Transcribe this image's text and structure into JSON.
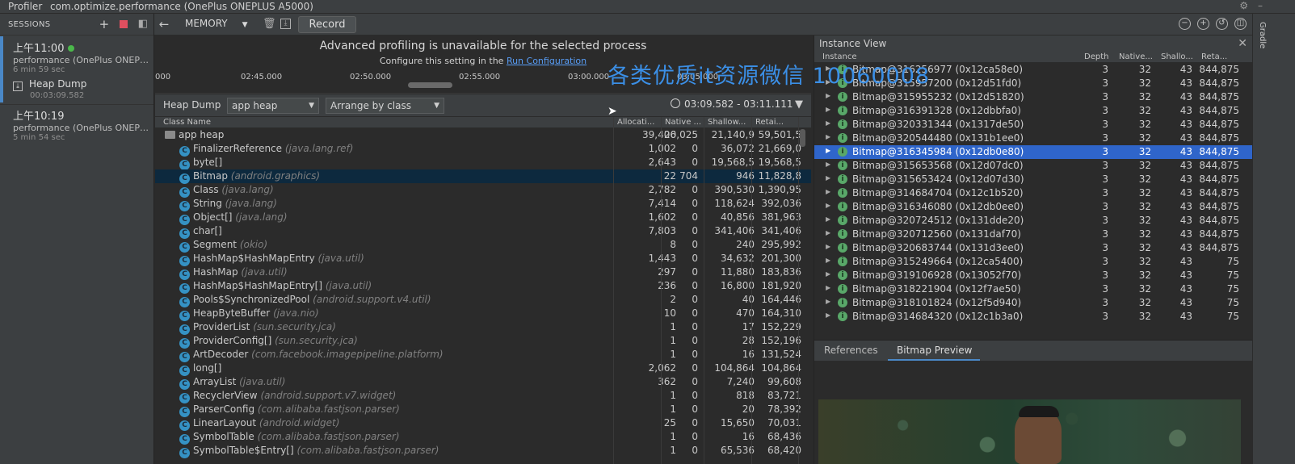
{
  "titlebar": {
    "tab1": "Profiler",
    "tab2": "com.optimize.performance (OnePlus ONEPLUS A5000)"
  },
  "sessions": {
    "header": "SESSIONS",
    "items": [
      {
        "time": "上午11:00",
        "device": "performance (OnePlus ONEPLUS ...",
        "duration": "6 min 59 sec"
      },
      {
        "label": "Heap Dump",
        "duration": "00:03:09.582"
      },
      {
        "time": "上午10:19",
        "device": "performance (OnePlus ONEPLUS ...",
        "duration": "5 min 54 sec"
      }
    ]
  },
  "toolbar": {
    "profiler": "MEMORY",
    "record": "Record"
  },
  "banner": {
    "line1": "Advanced profiling is unavailable for the selected process",
    "line2_prefix": "Configure this setting in the",
    "link": "Run Configuration"
  },
  "timeline": {
    "ticks": [
      "000",
      "02:45.000",
      "02:50.000",
      "02:55.000",
      "03:00.000",
      "03:05.000"
    ]
  },
  "filterbar": {
    "view": "Heap Dump",
    "heap": "app heap",
    "arrange": "Arrange by class",
    "range": "03:09.582 - 03:11.111"
  },
  "class_table": {
    "headers": [
      "Class Name",
      "Allocati...",
      "Native ...",
      "Shallow...",
      "Retai..."
    ],
    "root": {
      "name": "app heap",
      "alloc": "39,406",
      "native": "20,025",
      "shallow": "21,140,9",
      "retained": "59,501,5"
    },
    "rows": [
      {
        "name": "FinalizerReference",
        "pkg": "(java.lang.ref)",
        "alloc": "1,002",
        "native": "0",
        "shallow": "36,072",
        "retained": "21,669,0"
      },
      {
        "name": "byte[]",
        "pkg": "",
        "alloc": "2,643",
        "native": "0",
        "shallow": "19,568,5",
        "retained": "19,568,5"
      },
      {
        "name": "Bitmap",
        "pkg": "(android.graphics)",
        "alloc": "22",
        "native": "704",
        "shallow": "946",
        "retained": "11,828,8"
      },
      {
        "name": "Class",
        "pkg": "(java.lang)",
        "alloc": "2,782",
        "native": "0",
        "shallow": "390,530",
        "retained": "1,390,95"
      },
      {
        "name": "String",
        "pkg": "(java.lang)",
        "alloc": "7,414",
        "native": "0",
        "shallow": "118,624",
        "retained": "392,036"
      },
      {
        "name": "Object[]",
        "pkg": "(java.lang)",
        "alloc": "1,602",
        "native": "0",
        "shallow": "40,856",
        "retained": "381,963"
      },
      {
        "name": "char[]",
        "pkg": "",
        "alloc": "7,803",
        "native": "0",
        "shallow": "341,406",
        "retained": "341,406"
      },
      {
        "name": "Segment",
        "pkg": "(okio)",
        "alloc": "8",
        "native": "0",
        "shallow": "240",
        "retained": "295,992"
      },
      {
        "name": "HashMap$HashMapEntry",
        "pkg": "(java.util)",
        "alloc": "1,443",
        "native": "0",
        "shallow": "34,632",
        "retained": "201,300"
      },
      {
        "name": "HashMap",
        "pkg": "(java.util)",
        "alloc": "297",
        "native": "0",
        "shallow": "11,880",
        "retained": "183,836"
      },
      {
        "name": "HashMap$HashMapEntry[]",
        "pkg": "(java.util)",
        "alloc": "236",
        "native": "0",
        "shallow": "16,800",
        "retained": "181,920"
      },
      {
        "name": "Pools$SynchronizedPool",
        "pkg": "(android.support.v4.util)",
        "alloc": "2",
        "native": "0",
        "shallow": "40",
        "retained": "164,446"
      },
      {
        "name": "HeapByteBuffer",
        "pkg": "(java.nio)",
        "alloc": "10",
        "native": "0",
        "shallow": "470",
        "retained": "164,310"
      },
      {
        "name": "ProviderList",
        "pkg": "(sun.security.jca)",
        "alloc": "1",
        "native": "0",
        "shallow": "17",
        "retained": "152,229"
      },
      {
        "name": "ProviderConfig[]",
        "pkg": "(sun.security.jca)",
        "alloc": "1",
        "native": "0",
        "shallow": "28",
        "retained": "152,196"
      },
      {
        "name": "ArtDecoder",
        "pkg": "(com.facebook.imagepipeline.platform)",
        "alloc": "1",
        "native": "0",
        "shallow": "16",
        "retained": "131,524"
      },
      {
        "name": "long[]",
        "pkg": "",
        "alloc": "2,062",
        "native": "0",
        "shallow": "104,864",
        "retained": "104,864"
      },
      {
        "name": "ArrayList",
        "pkg": "(java.util)",
        "alloc": "362",
        "native": "0",
        "shallow": "7,240",
        "retained": "99,608"
      },
      {
        "name": "RecyclerView",
        "pkg": "(android.support.v7.widget)",
        "alloc": "1",
        "native": "0",
        "shallow": "818",
        "retained": "83,721"
      },
      {
        "name": "ParserConfig",
        "pkg": "(com.alibaba.fastjson.parser)",
        "alloc": "1",
        "native": "0",
        "shallow": "20",
        "retained": "78,392"
      },
      {
        "name": "LinearLayout",
        "pkg": "(android.widget)",
        "alloc": "25",
        "native": "0",
        "shallow": "15,650",
        "retained": "70,031"
      },
      {
        "name": "SymbolTable",
        "pkg": "(com.alibaba.fastjson.parser)",
        "alloc": "1",
        "native": "0",
        "shallow": "16",
        "retained": "68,436"
      },
      {
        "name": "SymbolTable$Entry[]",
        "pkg": "(com.alibaba.fastjson.parser)",
        "alloc": "1",
        "native": "0",
        "shallow": "65,536",
        "retained": "68,420"
      }
    ],
    "selected_index": 2
  },
  "instance_view": {
    "title": "Instance View",
    "headers": [
      "Instance",
      "Depth",
      "Native...",
      "Shallo...",
      "Reta..."
    ],
    "rows": [
      {
        "name": "Bitmap@316256977 (0x12ca58e0)",
        "depth": "3",
        "native": "32",
        "shallow": "43",
        "retained": "844,875"
      },
      {
        "name": "Bitmap@315957200 (0x12d51fd0)",
        "depth": "3",
        "native": "32",
        "shallow": "43",
        "retained": "844,875"
      },
      {
        "name": "Bitmap@315955232 (0x12d51820)",
        "depth": "3",
        "native": "32",
        "shallow": "43",
        "retained": "844,875"
      },
      {
        "name": "Bitmap@316391328 (0x12dbbfa0)",
        "depth": "3",
        "native": "32",
        "shallow": "43",
        "retained": "844,875"
      },
      {
        "name": "Bitmap@320331344 (0x1317de50)",
        "depth": "3",
        "native": "32",
        "shallow": "43",
        "retained": "844,875"
      },
      {
        "name": "Bitmap@320544480 (0x131b1ee0)",
        "depth": "3",
        "native": "32",
        "shallow": "43",
        "retained": "844,875"
      },
      {
        "name": "Bitmap@316345984 (0x12db0e80)",
        "depth": "3",
        "native": "32",
        "shallow": "43",
        "retained": "844,875"
      },
      {
        "name": "Bitmap@315653568 (0x12d07dc0)",
        "depth": "3",
        "native": "32",
        "shallow": "43",
        "retained": "844,875"
      },
      {
        "name": "Bitmap@315653424 (0x12d07d30)",
        "depth": "3",
        "native": "32",
        "shallow": "43",
        "retained": "844,875"
      },
      {
        "name": "Bitmap@314684704 (0x12c1b520)",
        "depth": "3",
        "native": "32",
        "shallow": "43",
        "retained": "844,875"
      },
      {
        "name": "Bitmap@316346080 (0x12db0ee0)",
        "depth": "3",
        "native": "32",
        "shallow": "43",
        "retained": "844,875"
      },
      {
        "name": "Bitmap@320724512 (0x131dde20)",
        "depth": "3",
        "native": "32",
        "shallow": "43",
        "retained": "844,875"
      },
      {
        "name": "Bitmap@320712560 (0x131daf70)",
        "depth": "3",
        "native": "32",
        "shallow": "43",
        "retained": "844,875"
      },
      {
        "name": "Bitmap@320683744 (0x131d3ee0)",
        "depth": "3",
        "native": "32",
        "shallow": "43",
        "retained": "844,875"
      },
      {
        "name": "Bitmap@315249664 (0x12ca5400)",
        "depth": "3",
        "native": "32",
        "shallow": "43",
        "retained": "75"
      },
      {
        "name": "Bitmap@319106928 (0x13052f70)",
        "depth": "3",
        "native": "32",
        "shallow": "43",
        "retained": "75"
      },
      {
        "name": "Bitmap@318221904 (0x12f7ae50)",
        "depth": "3",
        "native": "32",
        "shallow": "43",
        "retained": "75"
      },
      {
        "name": "Bitmap@318101824 (0x12f5d940)",
        "depth": "3",
        "native": "32",
        "shallow": "43",
        "retained": "75"
      },
      {
        "name": "Bitmap@314684320 (0x12c1b3a0)",
        "depth": "3",
        "native": "32",
        "shallow": "43",
        "retained": "75"
      }
    ],
    "selected_index": 6,
    "tabs": [
      "References",
      "Bitmap Preview"
    ]
  },
  "right_strip": {
    "label": "Gradle"
  },
  "watermark": "各类优质it资源微信 10060008",
  "colors": {
    "accent": "#2f65ca",
    "link": "#589df6",
    "record_dot": "#e04f5f",
    "live_dot": "#4bb84b"
  }
}
